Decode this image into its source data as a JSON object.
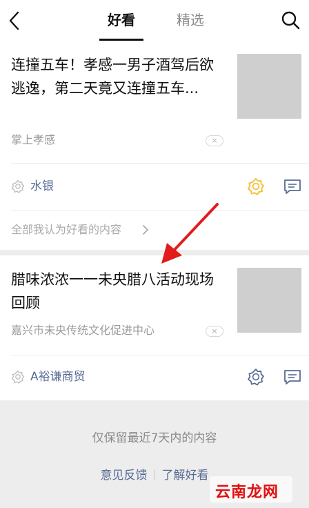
{
  "header": {
    "tabs": [
      {
        "label": "好看",
        "active": true
      },
      {
        "label": "精选",
        "active": false
      }
    ]
  },
  "articles": [
    {
      "title": "连撞五车！孝感一男子酒驾后欲逃逸，第二天竟又连撞五车...",
      "source": "掌上孝感",
      "friend": "水银",
      "liked": true
    },
    {
      "title": "腊味浓浓一一未央腊八活动现场回顾",
      "source": "嘉兴市未央传统文化促进中心",
      "friend": "A裕谦商贸",
      "liked": false
    }
  ],
  "see_all": "全部我认为好看的内容",
  "footer": {
    "note": "仅保留最近7天内的内容",
    "feedback_label": "意见反馈",
    "learn_label": "了解好看"
  },
  "watermark": "云南龙网",
  "colors": {
    "link": "#576b95",
    "like_active": "#f5c142",
    "annotation_arrow": "#e21b1b"
  }
}
